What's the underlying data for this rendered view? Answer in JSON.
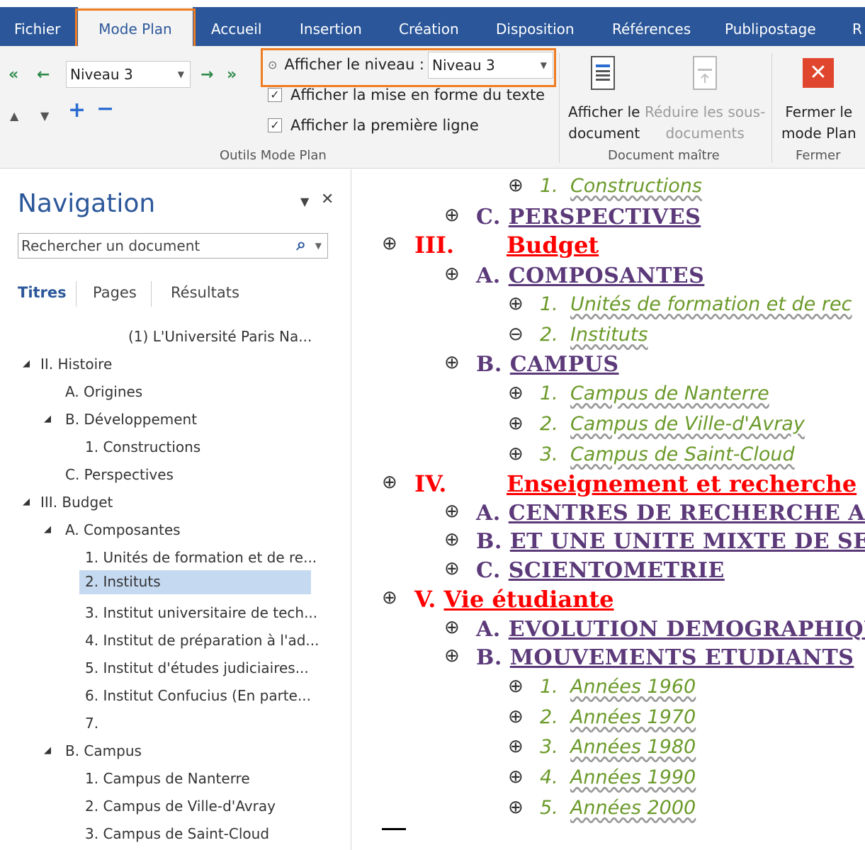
{
  "ribbon": {
    "tabs": [
      "Fichier",
      "Mode Plan",
      "Accueil",
      "Insertion",
      "Création",
      "Disposition",
      "Références",
      "Publipostage",
      "R"
    ],
    "active_tab": "Mode Plan",
    "level_combo_value": "Niveau 3",
    "show_level_label": "Afficher le niveau :",
    "show_level_value": "Niveau 3",
    "show_formatting_label": "Afficher la mise en forme du texte",
    "show_first_line_label": "Afficher la première ligne",
    "outline_tools_label": "Outils Mode Plan",
    "show_document_label_1": "Afficher le",
    "show_document_label_2": "document",
    "collapse_subdocs_label_1": "Réduire les sous-",
    "collapse_subdocs_label_2": "documents",
    "master_document_label": "Document maître",
    "close_outline_label_1": "Fermer le",
    "close_outline_label_2": "mode Plan",
    "close_group_label": "Fermer"
  },
  "navigation": {
    "title": "Navigation",
    "search_placeholder": "Rechercher un document",
    "tabs": [
      "Titres",
      "Pages",
      "Résultats"
    ],
    "items": [
      "(1) L'Université Paris Na...",
      "II. Histoire",
      "A. Origines",
      "B. Développement",
      "1. Constructions",
      "C. Perspectives",
      "III. Budget",
      "A. Composantes",
      "1. Unités de formation et de re...",
      "2. Instituts",
      "3. Institut universitaire de tech...",
      "4. Institut de préparation à l'ad...",
      "5. Institut d'études judiciaires...",
      "6. Institut Confucius (En parte...",
      "7.",
      "B. Campus",
      "1. Campus de Nanterre",
      "2. Campus de Ville-d'Avray",
      "3. Campus de Saint-Cloud"
    ]
  },
  "outline": {
    "items": [
      {
        "num": "1.",
        "text": "Constructions"
      },
      {
        "num": "C.",
        "text": "Perspectives"
      },
      {
        "num": "III.",
        "text": "Budget"
      },
      {
        "num": "A.",
        "text": "Composantes"
      },
      {
        "num": "1.",
        "text": "Unités de formation et de rec"
      },
      {
        "num": "2.",
        "text": "Instituts"
      },
      {
        "num": "B.",
        "text": "Campus"
      },
      {
        "num": "1.",
        "text": "Campus de Nanterre"
      },
      {
        "num": "2.",
        "text": "Campus de Ville-d'Avray"
      },
      {
        "num": "3.",
        "text": "Campus de Saint-Cloud"
      },
      {
        "num": "IV.",
        "text": "Enseignement et recherche"
      },
      {
        "num": "A.",
        "text": "Centres de recherche actue"
      },
      {
        "num": "B.",
        "text": "Et une unite mixte de servic"
      },
      {
        "num": "C.",
        "text": "Scientometrie"
      },
      {
        "num": "V.",
        "text": "Vie étudiante"
      },
      {
        "num": "A.",
        "text": "Evolution demographique"
      },
      {
        "num": "B.",
        "text": "Mouvements etudiants"
      },
      {
        "num": "1.",
        "text": "Années 1960"
      },
      {
        "num": "2.",
        "text": "Années 1970"
      },
      {
        "num": "3.",
        "text": "Années 1980"
      },
      {
        "num": "4.",
        "text": "Années 1990"
      },
      {
        "num": "5.",
        "text": "Années 2000"
      }
    ]
  }
}
